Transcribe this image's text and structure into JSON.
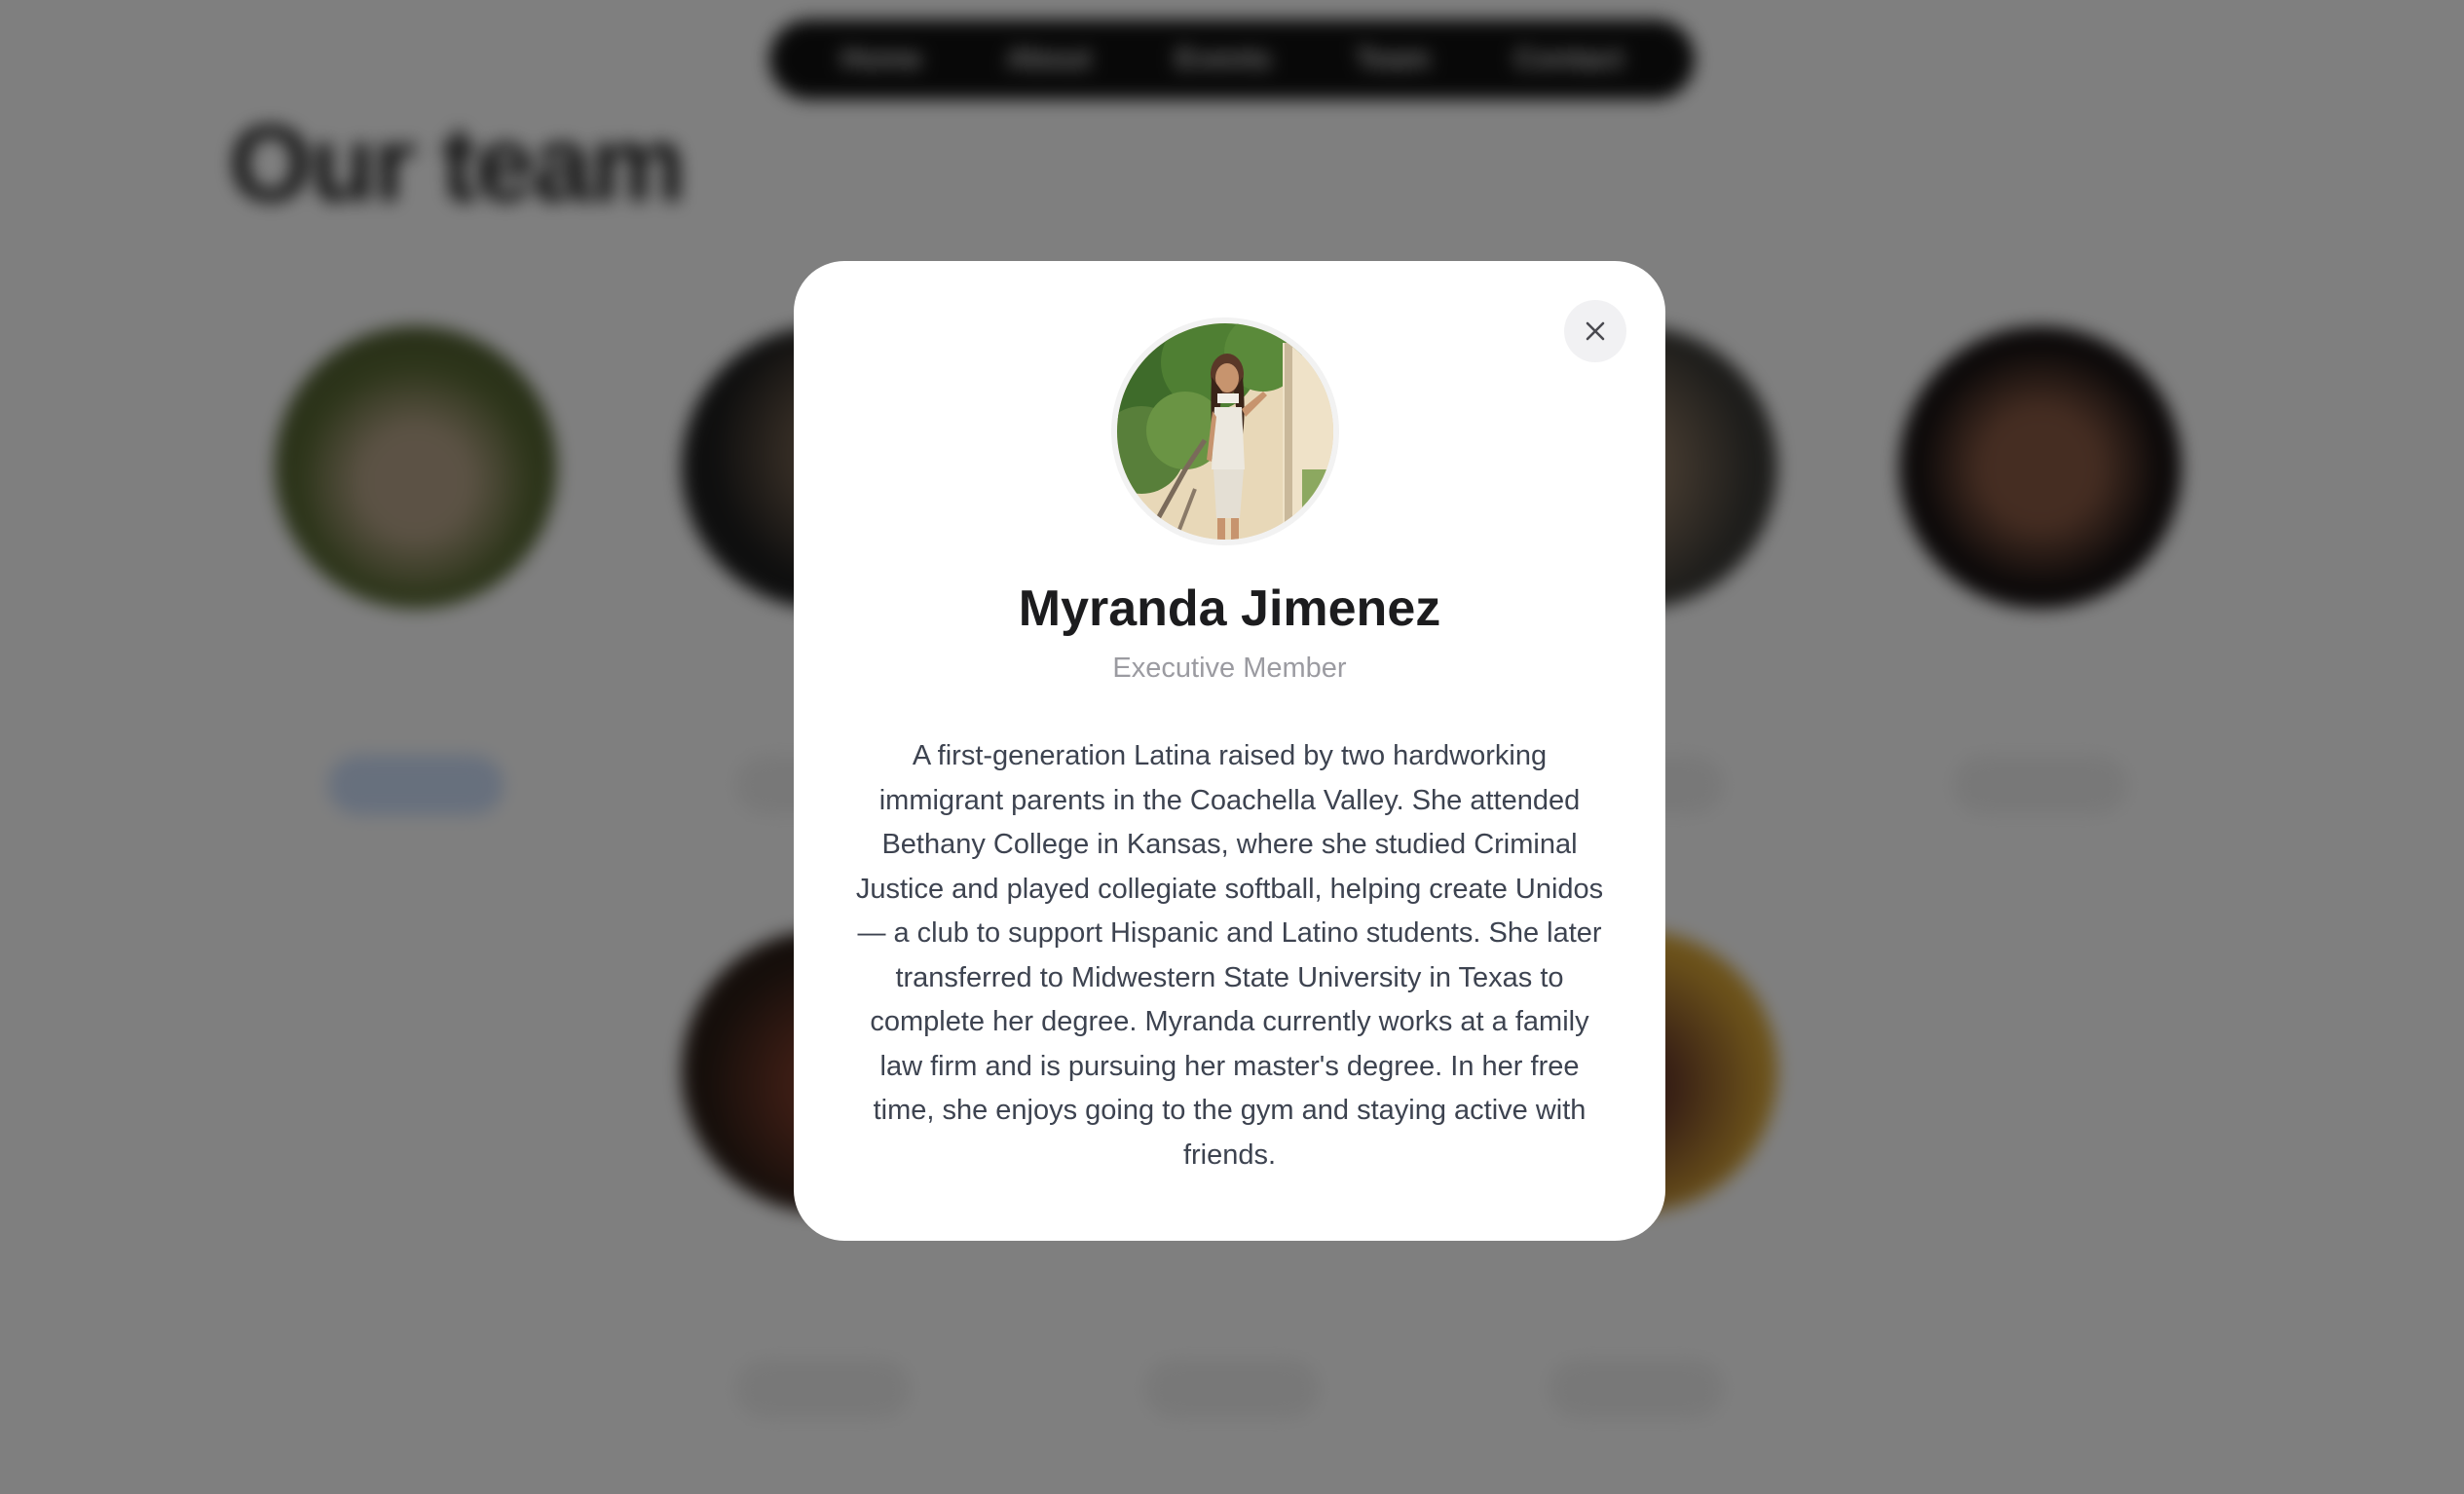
{
  "page": {
    "title": "Our team",
    "nav_items": [
      "Home",
      "About",
      "Events",
      "Team",
      "Contact"
    ]
  },
  "modal": {
    "name": "Myranda Jimenez",
    "role": "Executive Member",
    "bio": "A first-generation Latina raised by two hardworking immigrant parents in the Coachella Valley. She attended Bethany College in Kansas, where she studied Criminal Justice and played collegiate softball, helping create Unidos — a club to support Hispanic and Latino students. She later transferred to Midwestern State University in Texas to complete her degree. Myranda currently works at a family law firm and is pursuing her master's degree. In her free time, she enjoys going to the gym and staying active with friends.",
    "close_icon": "close-icon"
  },
  "colors": {
    "overlay": "#000000",
    "modal_bg": "#ffffff",
    "name_text": "#1c1c1e",
    "role_text": "#9b9ba1",
    "bio_text": "#3d4350"
  }
}
